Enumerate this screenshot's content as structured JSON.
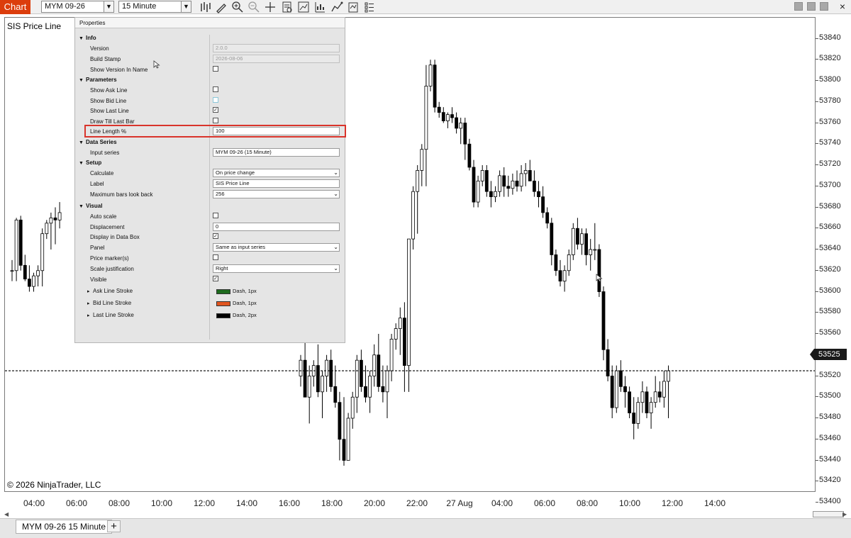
{
  "toolbar": {
    "chart_tab": "Chart",
    "instrument": "MYM 09-26",
    "interval": "15 Minute",
    "icons": [
      "bar-type-icon",
      "drawing-tool-icon",
      "zoom-in-icon",
      "zoom-out-icon",
      "crosshair-icon",
      "data-box-icon",
      "indicators-icon",
      "strategies-icon",
      "chart-trader-icon",
      "templates-icon",
      "properties-icon"
    ]
  },
  "window_controls": {
    "close": "×"
  },
  "chart": {
    "indicator_label": "SIS Price Line",
    "copyright": "© 2026 NinjaTrader, LLC",
    "current_price": "53525",
    "price_ticks": [
      "53840",
      "53820",
      "53800",
      "53780",
      "53760",
      "53740",
      "53720",
      "53700",
      "53680",
      "53660",
      "53640",
      "53620",
      "53600",
      "53580",
      "53560",
      "53540",
      "53520",
      "53500",
      "53480",
      "53460",
      "53440",
      "53420",
      "53400"
    ],
    "time_ticks": [
      "04:00",
      "06:00",
      "08:00",
      "10:00",
      "12:00",
      "14:00",
      "16:00",
      "18:00",
      "20:00",
      "22:00",
      "27 Aug",
      "04:00",
      "06:00",
      "08:00",
      "10:00",
      "12:00",
      "14:00"
    ],
    "candles_left": [
      [
        53620,
        53630,
        53610,
        53620
      ],
      [
        53620,
        53670,
        53610,
        53668
      ],
      [
        53668,
        53672,
        53620,
        53625
      ],
      [
        53625,
        53635,
        53610,
        53612
      ],
      [
        53612,
        53625,
        53600,
        53605
      ],
      [
        53605,
        53618,
        53600,
        53615
      ],
      [
        53615,
        53625,
        53605,
        53620
      ],
      [
        53620,
        53660,
        53605,
        53655
      ],
      [
        53655,
        53668,
        53650,
        53665
      ],
      [
        53665,
        53675,
        53640,
        53670
      ],
      [
        53670,
        53680,
        53645,
        53668
      ],
      [
        53668,
        53685,
        53660,
        53675
      ]
    ],
    "candles_right": [
      [
        53520,
        53540,
        53510,
        53535
      ],
      [
        53535,
        53560,
        53500,
        53500
      ],
      [
        53500,
        53530,
        53475,
        53520
      ],
      [
        53520,
        53535,
        53510,
        53530
      ],
      [
        53530,
        53550,
        53500,
        53505
      ],
      [
        53505,
        53525,
        53480,
        53520
      ],
      [
        53520,
        53540,
        53505,
        53535
      ],
      [
        53535,
        53545,
        53505,
        53510
      ],
      [
        53510,
        53530,
        53490,
        53495
      ],
      [
        53495,
        53505,
        53440,
        53460
      ],
      [
        53460,
        53500,
        53435,
        53440
      ],
      [
        53440,
        53485,
        53440,
        53480
      ],
      [
        53480,
        53505,
        53470,
        53500
      ],
      [
        53500,
        53540,
        53485,
        53535
      ],
      [
        53535,
        53545,
        53505,
        53510
      ],
      [
        53510,
        53530,
        53495,
        53500
      ],
      [
        53500,
        53525,
        53485,
        53520
      ],
      [
        53520,
        53550,
        53510,
        53540
      ],
      [
        53540,
        53560,
        53505,
        53510
      ],
      [
        53510,
        53530,
        53495,
        53505
      ],
      [
        53505,
        53530,
        53480,
        53525
      ],
      [
        53525,
        53560,
        53515,
        53555
      ],
      [
        53555,
        53570,
        53545,
        53565
      ],
      [
        53565,
        53585,
        53540,
        53575
      ],
      [
        53575,
        53590,
        53505,
        53530
      ],
      [
        53530,
        53650,
        53505,
        53650
      ],
      [
        53650,
        53700,
        53640,
        53695
      ],
      [
        53695,
        53720,
        53655,
        53715
      ],
      [
        53715,
        53740,
        53700,
        53735
      ],
      [
        53735,
        53815,
        53700,
        53795
      ],
      [
        53795,
        53820,
        53790,
        53815
      ],
      [
        53815,
        53820,
        53770,
        53775
      ],
      [
        53775,
        53780,
        53765,
        53770
      ],
      [
        53770,
        53775,
        53760,
        53762
      ],
      [
        53762,
        53770,
        53755,
        53768
      ],
      [
        53768,
        53775,
        53760,
        53765
      ],
      [
        53765,
        53770,
        53750,
        53755
      ],
      [
        53755,
        53765,
        53740,
        53760
      ],
      [
        53760,
        53765,
        53725,
        53740
      ],
      [
        53740,
        53745,
        53715,
        53718
      ],
      [
        53718,
        53725,
        53680,
        53685
      ],
      [
        53685,
        53710,
        53680,
        53705
      ],
      [
        53705,
        53720,
        53700,
        53715
      ],
      [
        53715,
        53720,
        53690,
        53695
      ],
      [
        53695,
        53705,
        53680,
        53690
      ],
      [
        53690,
        53700,
        53685,
        53695
      ],
      [
        53695,
        53715,
        53690,
        53710
      ],
      [
        53710,
        53718,
        53690,
        53700
      ],
      [
        53700,
        53710,
        53690,
        53698
      ],
      [
        53698,
        53712,
        53692,
        53705
      ],
      [
        53705,
        53715,
        53695,
        53700
      ],
      [
        53700,
        53720,
        53695,
        53712
      ],
      [
        53712,
        53722,
        53700,
        53715
      ],
      [
        53715,
        53725,
        53705,
        53705
      ],
      [
        53705,
        53715,
        53690,
        53695
      ],
      [
        53695,
        53705,
        53680,
        53690
      ],
      [
        53690,
        53700,
        53670,
        53675
      ],
      [
        53675,
        53680,
        53660,
        53665
      ],
      [
        53665,
        53670,
        53625,
        53635
      ],
      [
        53635,
        53640,
        53615,
        53620
      ],
      [
        53620,
        53630,
        53605,
        53610
      ],
      [
        53610,
        53625,
        53600,
        53620
      ],
      [
        53620,
        53640,
        53615,
        53635
      ],
      [
        53635,
        53665,
        53630,
        53660
      ],
      [
        53660,
        53670,
        53640,
        53645
      ],
      [
        53645,
        53660,
        53635,
        53655
      ],
      [
        53655,
        53660,
        53625,
        53635
      ],
      [
        53635,
        53650,
        53620,
        53640
      ],
      [
        53640,
        53665,
        53630,
        53640
      ],
      [
        53640,
        53645,
        53595,
        53600
      ],
      [
        53600,
        53605,
        53535,
        53545
      ],
      [
        53545,
        53555,
        53515,
        53520
      ],
      [
        53520,
        53530,
        53480,
        53490
      ],
      [
        53490,
        53530,
        53485,
        53525
      ],
      [
        53525,
        53535,
        53505,
        53510
      ],
      [
        53510,
        53520,
        53490,
        53505
      ],
      [
        53505,
        53510,
        53480,
        53485
      ],
      [
        53485,
        53500,
        53460,
        53475
      ],
      [
        53475,
        53500,
        53470,
        53495
      ],
      [
        53495,
        53515,
        53485,
        53505
      ],
      [
        53505,
        53510,
        53480,
        53485
      ],
      [
        53485,
        53500,
        53470,
        53495
      ],
      [
        53495,
        53520,
        53490,
        53505
      ],
      [
        53505,
        53515,
        53495,
        53500
      ],
      [
        53500,
        53525,
        53490,
        53515
      ],
      [
        53515,
        53530,
        53480,
        53525
      ]
    ]
  },
  "properties": {
    "title": "Properties",
    "sections": {
      "info": "Info",
      "parameters": "Parameters",
      "data_series": "Data Series",
      "setup": "Setup",
      "visual": "Visual"
    },
    "labels": {
      "version": "Version",
      "build_stamp": "Build Stamp",
      "show_version_in_name": "Show Version In Name",
      "show_ask_line": "Show Ask Line",
      "show_bid_line": "Show Bid Line",
      "show_last_line": "Show Last Line",
      "draw_till_last_bar": "Draw Till Last Bar",
      "line_length": "Line Length %",
      "input_series": "Input series",
      "calculate": "Calculate",
      "label": "Label",
      "max_bars_look_back": "Maximum bars look back",
      "auto_scale": "Auto scale",
      "displacement": "Displacement",
      "display_in_data_box": "Display in Data Box",
      "panel": "Panel",
      "price_markers": "Price marker(s)",
      "scale_justification": "Scale justification",
      "visible": "Visible",
      "ask_line_stroke": "Ask Line Stroke",
      "bid_line_stroke": "Bid Line Stroke",
      "last_line_stroke": "Last Line Stroke"
    },
    "values": {
      "version": "2.0.0",
      "build_stamp": "2026-08-06",
      "line_length": "100",
      "input_series": "MYM 09-26 (15 Minute)",
      "calculate": "On price change",
      "label": "SIS Price Line",
      "max_bars_look_back": "256",
      "displacement": "0",
      "panel": "Same as input series",
      "scale_justification": "Right",
      "ask_line_stroke": "Dash, 1px",
      "bid_line_stroke": "Dash, 1px",
      "last_line_stroke": "Dash, 2px"
    },
    "checks": {
      "show_version_in_name": false,
      "show_ask_line": false,
      "show_bid_line": false,
      "show_last_line": true,
      "draw_till_last_bar": false,
      "auto_scale": false,
      "display_in_data_box": true,
      "price_markers": false,
      "visible": true
    },
    "colors": {
      "ask_line": "#1e6b1e",
      "bid_line": "#e0551f",
      "last_line": "#000000",
      "highlight": "#d9342b"
    }
  },
  "bottom": {
    "instrument_tab": "MYM 09-26 15 Minute",
    "add_tab": "+"
  }
}
